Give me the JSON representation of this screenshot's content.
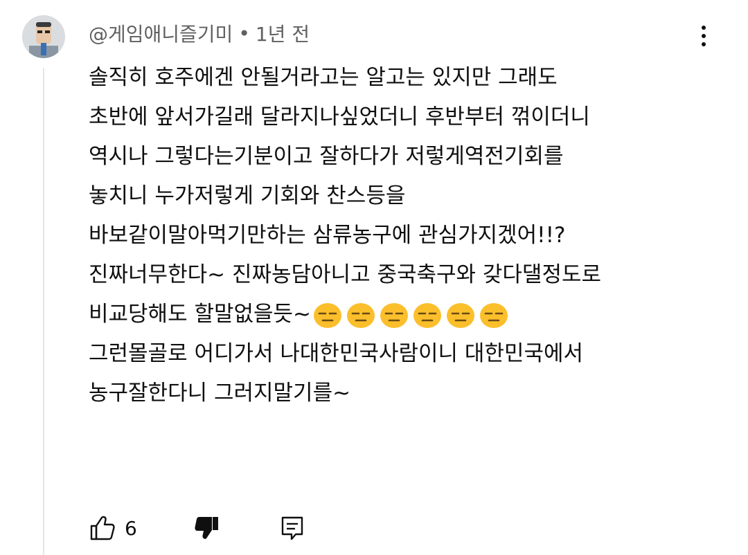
{
  "comment": {
    "author": "@게임애니즐기미",
    "separator": "•",
    "time": "1년 전",
    "lines": [
      "솔직히 호주에겐 안될거라고는 알고는 있지만 그래도",
      "초반에 앞서가길래 달라지나싶었더니 후반부터 꺾이더니",
      "역시나 그렇다는기분이고 잘하다가 저렇게역전기회를",
      "놓치니 누가저렇게 기회와 찬스등을",
      "바보같이말아먹기만하는 삼류농구에 관심가지겠어!!?",
      "진짜너무한다~ 진짜농담아니고 중국축구와 갖다댈정도로",
      "비교당해도 할말없을듯~",
      "그런몰골로 어디가서 나대한민국사람이니 대한민국에서",
      "농구잘한다니 그러지말기를~"
    ],
    "emoji_after_line_7": [
      "expressionless-face",
      "expressionless-face",
      "expressionless-face",
      "expressionless-face",
      "expressionless-face",
      "expressionless-face"
    ],
    "like_count": "6"
  },
  "icons": {
    "more": "vertical-ellipsis-icon",
    "like": "thumbs-up-outline-icon",
    "dislike": "thumbs-down-filled-icon",
    "reply": "comment-reply-icon"
  },
  "colors": {
    "text": "#0f0f0f",
    "meta_text": "#606060",
    "emoji_face": "#fbbf2c",
    "thread_line": "#e5e5e5"
  }
}
